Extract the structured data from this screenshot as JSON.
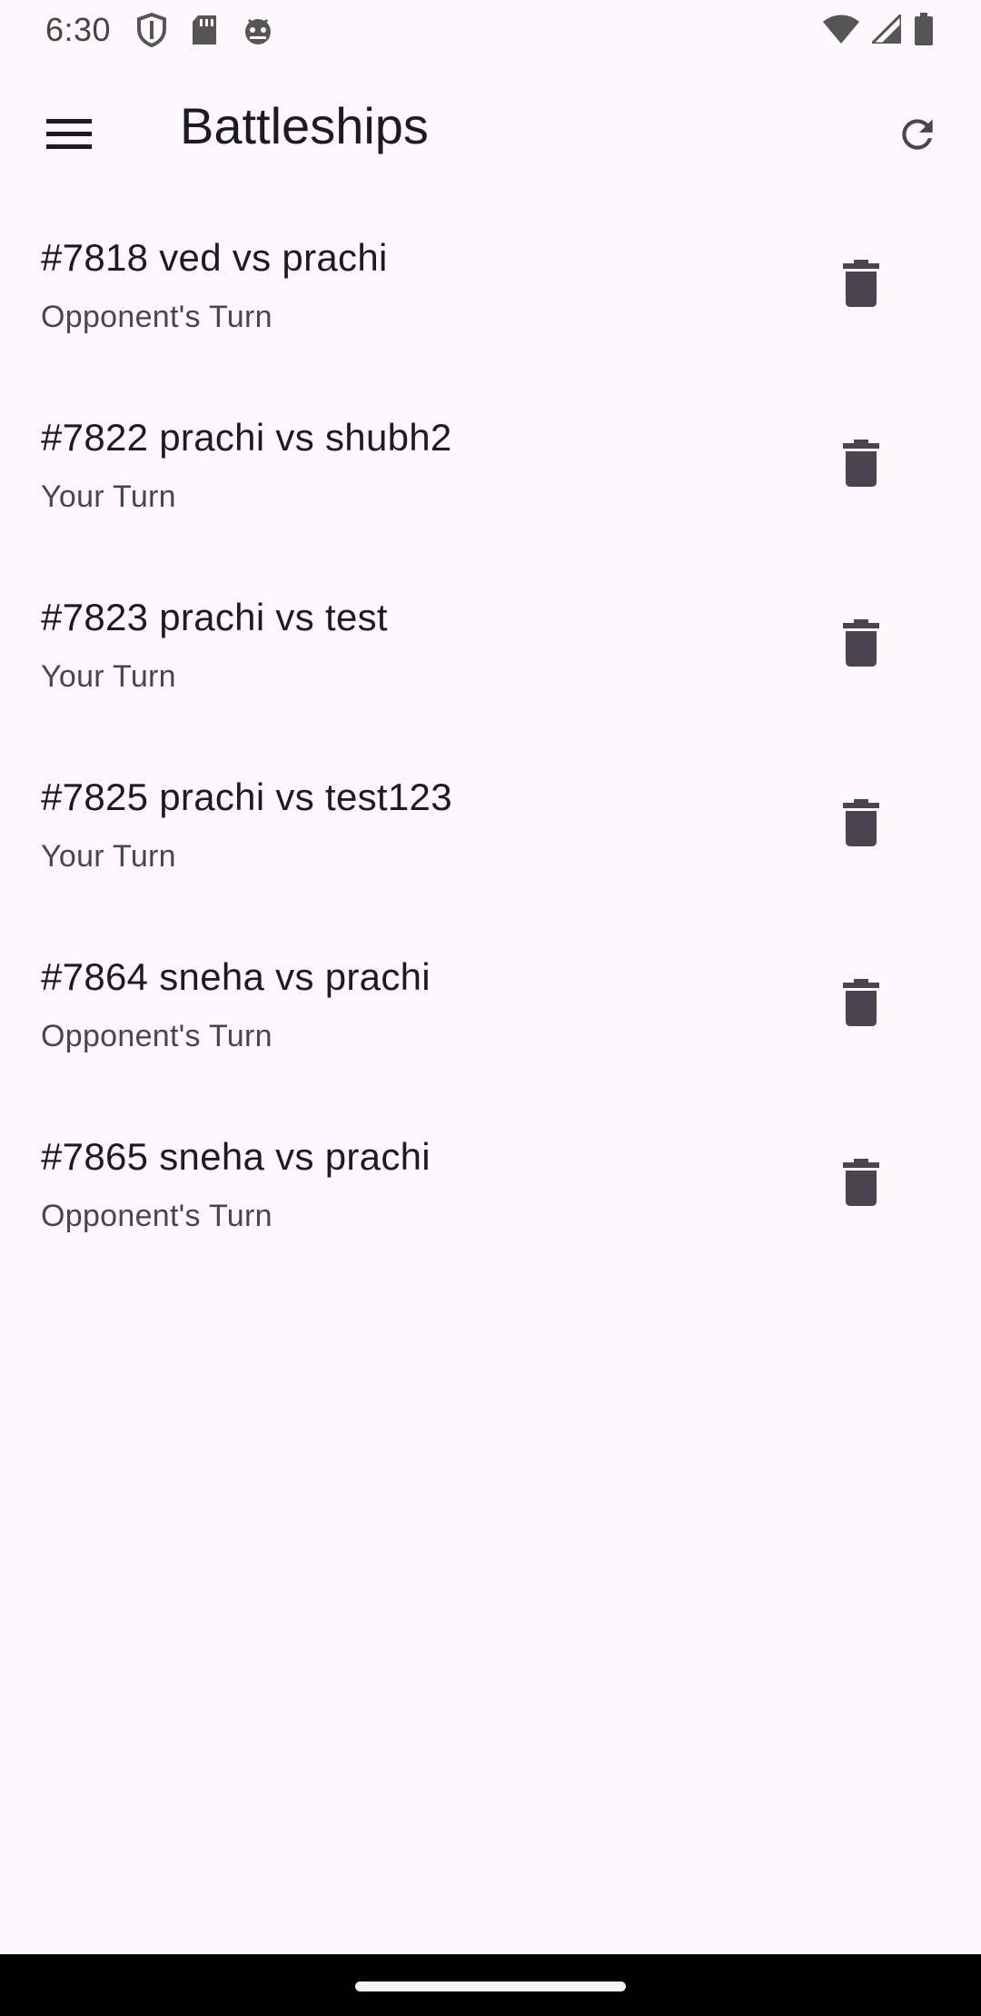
{
  "status_bar": {
    "time": "6:30",
    "left_icons": [
      "shield-icon",
      "sd-card-icon",
      "android-debug-icon"
    ],
    "right_icons": [
      "wifi-icon",
      "cell-signal-icon",
      "battery-icon"
    ]
  },
  "app_bar": {
    "title": "Battleships",
    "menu_icon": "menu-icon",
    "refresh_icon": "refresh-icon"
  },
  "games": [
    {
      "title": "#7818 ved vs prachi",
      "status": "Opponent's Turn"
    },
    {
      "title": "#7822 prachi vs shubh2",
      "status": "Your Turn"
    },
    {
      "title": "#7823 prachi vs test",
      "status": "Your Turn"
    },
    {
      "title": "#7825 prachi vs test123",
      "status": "Your Turn"
    },
    {
      "title": "#7864 sneha vs prachi",
      "status": "Opponent's Turn"
    },
    {
      "title": "#7865 sneha vs prachi",
      "status": "Opponent's Turn"
    }
  ],
  "colors": {
    "background": "#fef7fb",
    "text_primary": "#1c1b1f",
    "text_secondary": "#49454f",
    "icon": "#49454f"
  }
}
